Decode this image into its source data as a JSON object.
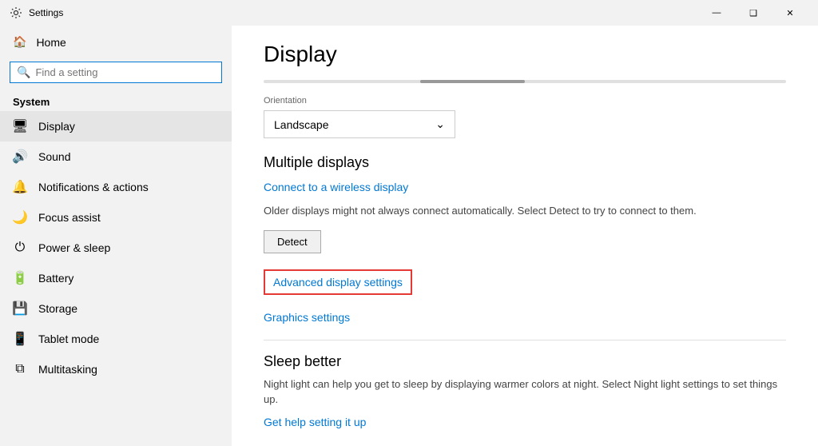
{
  "titlebar": {
    "app_name": "Settings",
    "minimize_label": "—",
    "maximize_label": "❑",
    "close_label": "✕"
  },
  "sidebar": {
    "home_label": "Home",
    "search_placeholder": "Find a setting",
    "search_icon": "🔍",
    "section_label": "System",
    "items": [
      {
        "id": "display",
        "label": "Display",
        "icon": "🖥"
      },
      {
        "id": "sound",
        "label": "Sound",
        "icon": "🔊"
      },
      {
        "id": "notifications",
        "label": "Notifications & actions",
        "icon": "🔔"
      },
      {
        "id": "focus",
        "label": "Focus assist",
        "icon": "🌙"
      },
      {
        "id": "power",
        "label": "Power & sleep",
        "icon": "⏻"
      },
      {
        "id": "battery",
        "label": "Battery",
        "icon": "🔋"
      },
      {
        "id": "storage",
        "label": "Storage",
        "icon": "💾"
      },
      {
        "id": "tablet",
        "label": "Tablet mode",
        "icon": "📱"
      },
      {
        "id": "multitasking",
        "label": "Multitasking",
        "icon": "⧉"
      }
    ]
  },
  "main": {
    "page_title": "Display",
    "orientation_label": "Orientation",
    "orientation_value": "Landscape",
    "multiple_displays_heading": "Multiple displays",
    "connect_wireless_link": "Connect to a wireless display",
    "detect_description": "Older displays might not always connect automatically. Select Detect to try to connect to them.",
    "detect_button": "Detect",
    "advanced_display_link": "Advanced display settings",
    "graphics_settings_link": "Graphics settings",
    "sleep_heading": "Sleep better",
    "sleep_description": "Night light can help you get to sleep by displaying warmer colors at night. Select Night light settings to set things up.",
    "night_light_link": "Get help setting it up"
  }
}
